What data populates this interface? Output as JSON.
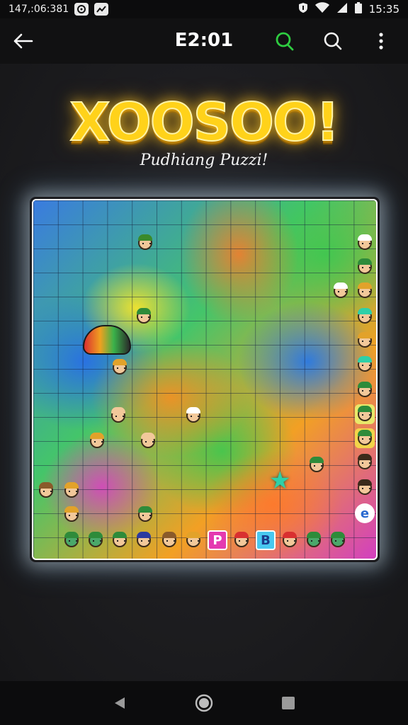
{
  "status_bar": {
    "left_text": "147,:06:381",
    "time": "15:35",
    "icons": [
      "notification-icon",
      "activity-icon",
      "shield-icon",
      "wifi-icon",
      "signal-icon",
      "battery-icon"
    ]
  },
  "app_bar": {
    "title": "E2:01",
    "icons": [
      "back-arrow-icon",
      "search-icon",
      "search-icon",
      "more-vert-icon"
    ],
    "accent_color": "#2ecc40"
  },
  "game": {
    "title": "XOOSOO!",
    "subtitle": "Pudhiang Puzzi!",
    "title_color": "#ffd21a",
    "board": {
      "tile_labels": [
        "P",
        "B",
        "e"
      ],
      "star_color": "#2ed0a8"
    }
  },
  "nav_bar": {
    "icons": [
      "back-triangle-icon",
      "home-circle-icon",
      "recents-square-icon"
    ]
  }
}
